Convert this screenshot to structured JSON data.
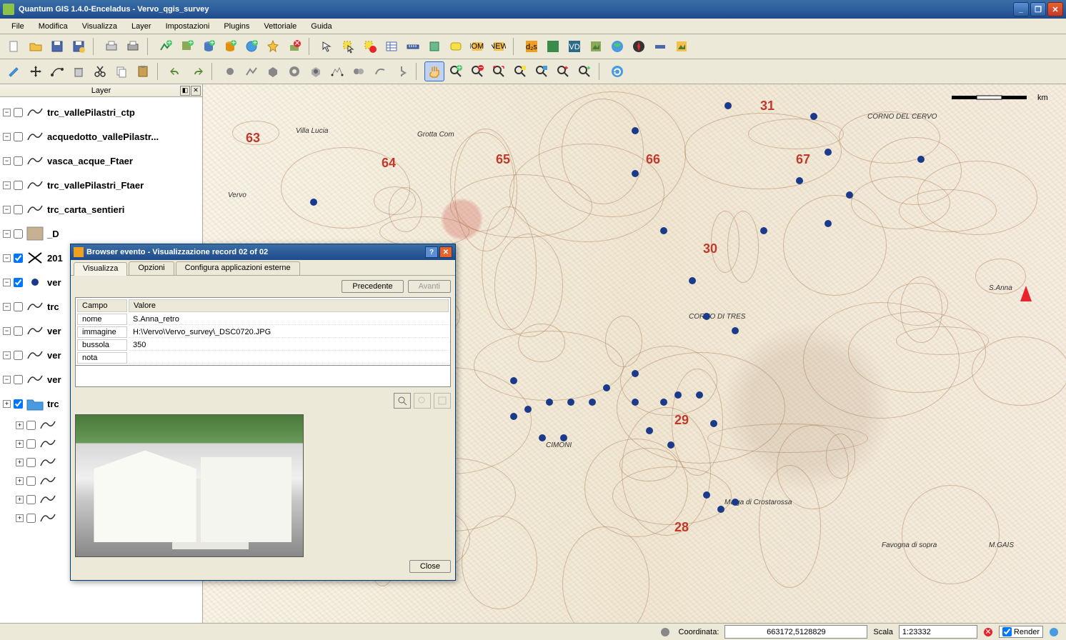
{
  "window": {
    "title": "Quantum GIS 1.4.0-Enceladus - Vervo_qgis_survey"
  },
  "menu": [
    "File",
    "Modifica",
    "Visualizza",
    "Layer",
    "Impostazioni",
    "Plugins",
    "Vettoriale",
    "Guida"
  ],
  "layers_panel": {
    "title": "Layer",
    "items": [
      {
        "label": "trc_vallePilastri_ctp",
        "checked": false
      },
      {
        "label": "acquedotto_vallePilastr...",
        "checked": false
      },
      {
        "label": "vasca_acque_Ftaer",
        "checked": false
      },
      {
        "label": "trc_vallePilastri_Ftaer",
        "checked": false
      },
      {
        "label": "trc_carta_sentieri",
        "checked": false
      },
      {
        "label": "_D",
        "checked": false,
        "raster": true
      },
      {
        "label": "201",
        "checked": true,
        "xmark": true
      },
      {
        "label": "ver",
        "checked": true,
        "xmark": true,
        "dot": true
      },
      {
        "label": "trc",
        "checked": false
      },
      {
        "label": "ver",
        "checked": false
      },
      {
        "label": "ver",
        "checked": false
      },
      {
        "label": "ver",
        "checked": false
      },
      {
        "label": "trc",
        "checked": true,
        "folder": true
      }
    ]
  },
  "dialog": {
    "title": "Browser evento - Visualizzazione record 02 of 02",
    "tabs": [
      "Visualizza",
      "Opzioni",
      "Configura applicazioni esterne"
    ],
    "active_tab": 0,
    "prev": "Precedente",
    "next": "Avanti",
    "columns": [
      "Campo",
      "Valore"
    ],
    "rows": [
      {
        "campo": "nome",
        "valore": "S.Anna_retro"
      },
      {
        "campo": "immagine",
        "valore": "H:\\Vervo\\Vervo_survey\\_DSC0720.JPG"
      },
      {
        "campo": "bussola",
        "valore": "350"
      },
      {
        "campo": "nota",
        "valore": ""
      }
    ],
    "close": "Close"
  },
  "map": {
    "scale_label": "km",
    "grid_nums": [
      "63",
      "64",
      "65",
      "66",
      "67",
      "30",
      "29",
      "28",
      "31"
    ],
    "places": [
      "Vervo",
      "Villa Lucia",
      "Grotta Com",
      "CORNO DI TRES",
      "CIMONI",
      "Malga di Crostarossa",
      "Favogna di sopra",
      "CORNO DEL CERVO",
      "S.Anna",
      "M.GAIS"
    ]
  },
  "status": {
    "coord_label": "Coordinata:",
    "coord_value": "663172,5128829",
    "scale_label": "Scala",
    "scale_value": "1:23332",
    "render": "Render"
  }
}
